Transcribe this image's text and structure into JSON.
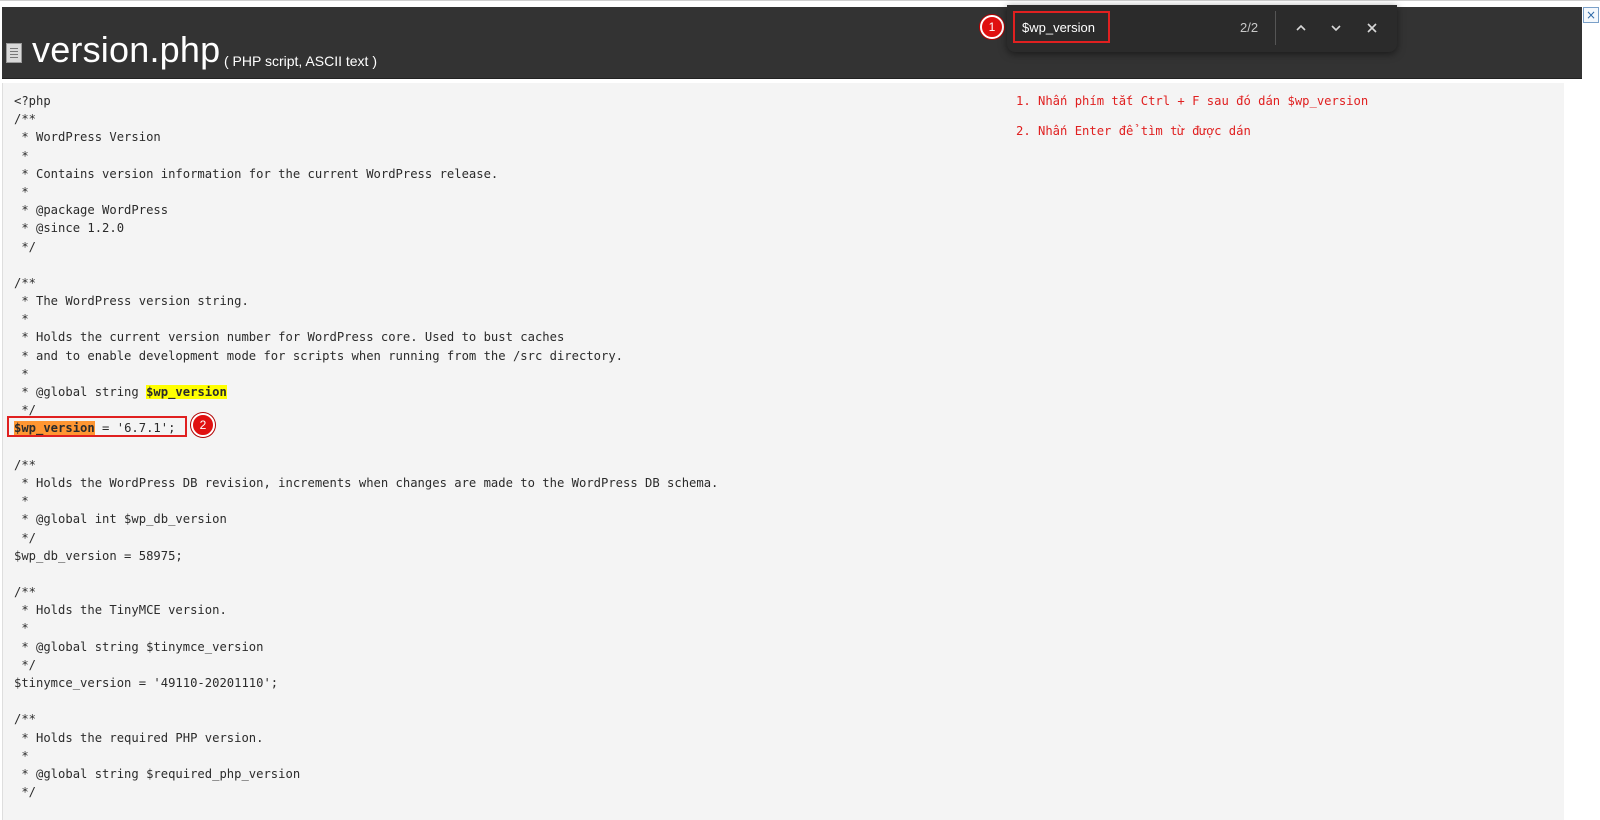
{
  "header": {
    "title": "version.php",
    "subtitle": "( PHP script, ASCII text )"
  },
  "find_bar": {
    "query": "$wp_version",
    "match_count": "2/2",
    "badge": "1"
  },
  "annotation": {
    "badge": "2"
  },
  "notes": [
    "1. Nhấn phím tắt Ctrl + F sau đó dán $wp_version",
    "2. Nhấn Enter để tìm từ được dán"
  ],
  "code": {
    "lines": [
      "<?php",
      "/**",
      " * WordPress Version",
      " *",
      " * Contains version information for the current WordPress release.",
      " *",
      " * @package WordPress",
      " * @since 1.2.0",
      " */",
      "",
      "/**",
      " * The WordPress version string.",
      " *",
      " * Holds the current version number for WordPress core. Used to bust caches",
      " * and to enable development mode for scripts when running from the /src directory.",
      " *",
      "",
      " */",
      "",
      "",
      "/**",
      " * Holds the WordPress DB revision, increments when changes are made to the WordPress DB schema.",
      " *",
      " * @global int $wp_db_version",
      " */",
      "$wp_db_version = 58975;",
      "",
      "/**",
      " * Holds the TinyMCE version.",
      " *",
      " * @global string $tinymce_version",
      " */",
      "$tinymce_version = '49110-20201110';",
      "",
      "/**",
      " * Holds the required PHP version.",
      " *",
      " * @global string $required_php_version",
      " */"
    ],
    "global_line_prefix": " * @global string ",
    "global_line_match": "$wp_version",
    "assign_line_match": "$wp_version",
    "assign_line_rest": " = '6.7.1';"
  }
}
